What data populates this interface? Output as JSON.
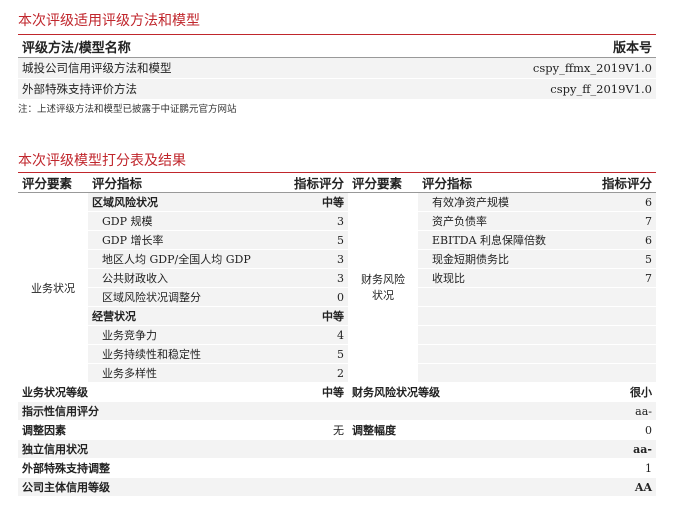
{
  "section1": {
    "title": "本次评级适用评级方法和模型",
    "header": {
      "name": "评级方法/模型名称",
      "version": "版本号"
    },
    "rows": [
      {
        "name": "城投公司信用评级方法和模型",
        "version": "cspy_ffmx_2019V1.0"
      },
      {
        "name": "外部特殊支持评价方法",
        "version": "cspy_ff_2019V1.0"
      }
    ],
    "note": "注：上述评级方法和模型已披露于中证鹏元官方网站"
  },
  "section2": {
    "title": "本次评级模型打分表及结果",
    "headers": [
      "评分要素",
      "评分指标",
      "指标评分",
      "评分要素",
      "评分指标",
      "指标评分"
    ],
    "left_group": "业务状况",
    "right_group": "财务风险状况",
    "left_rows": [
      {
        "label": "区域风险状况",
        "score": "中等",
        "bold": true
      },
      {
        "label": "GDP 规模",
        "score": "3"
      },
      {
        "label": "GDP 增长率",
        "score": "5"
      },
      {
        "label": "地区人均 GDP/全国人均 GDP",
        "score": "3"
      },
      {
        "label": "公共财政收入",
        "score": "3"
      },
      {
        "label": "区域风险状况调整分",
        "score": "0"
      },
      {
        "label": "经营状况",
        "score": "中等",
        "bold": true
      },
      {
        "label": "业务竞争力",
        "score": "4"
      },
      {
        "label": "业务持续性和稳定性",
        "score": "5"
      },
      {
        "label": "业务多样性",
        "score": "2"
      }
    ],
    "right_rows": [
      {
        "label": "有效净资产规模",
        "score": "6"
      },
      {
        "label": "资产负债率",
        "score": "7"
      },
      {
        "label": "EBITDA 利息保障倍数",
        "score": "6"
      },
      {
        "label": "现金短期债务比",
        "score": "5"
      },
      {
        "label": "收现比",
        "score": "7"
      }
    ],
    "summary": {
      "biz_level_label": "业务状况等级",
      "biz_level": "中等",
      "fin_level_label": "财务风险状况等级",
      "fin_level": "很小",
      "indicative_label": "指示性信用评分",
      "indicative": "aa-",
      "adjust_label": "调整因素",
      "adjust": "无",
      "adjust_range_label": "调整幅度",
      "adjust_range": "0",
      "standalone_label": "独立信用状况",
      "standalone": "aa-",
      "external_label": "外部特殊支持调整",
      "external": "1",
      "final_label": "公司主体信用等级",
      "final": "AA"
    }
  }
}
